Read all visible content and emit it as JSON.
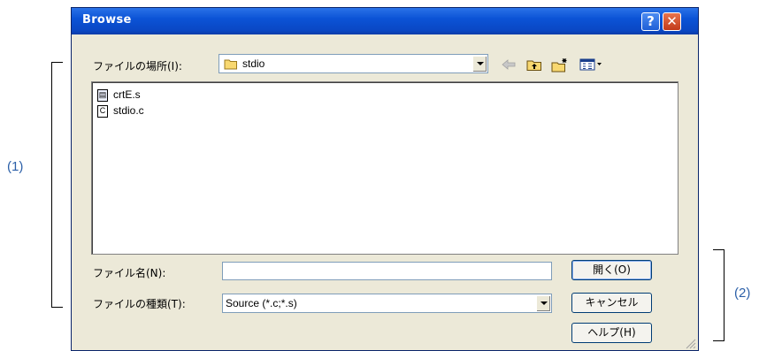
{
  "annotations": {
    "label_1": "(1)",
    "label_2": "(2)"
  },
  "dialog": {
    "title": "Browse",
    "help_glyph": "?",
    "close_glyph": "✕",
    "look_in_label": "ファイルの場所(I):",
    "look_in_value": "stdio",
    "files": [
      {
        "name": "crtE.s",
        "icon": "asm-file-icon"
      },
      {
        "name": "stdio.c",
        "icon": "c-file-icon"
      }
    ],
    "filename_label": "ファイル名(N):",
    "filename_value": "",
    "filetype_label": "ファイルの種類(T):",
    "filetype_value": "Source (*.c;*.s)",
    "open_button": "開く(O)",
    "cancel_button": "キャンセル",
    "help_button": "ヘルプ(H)"
  }
}
